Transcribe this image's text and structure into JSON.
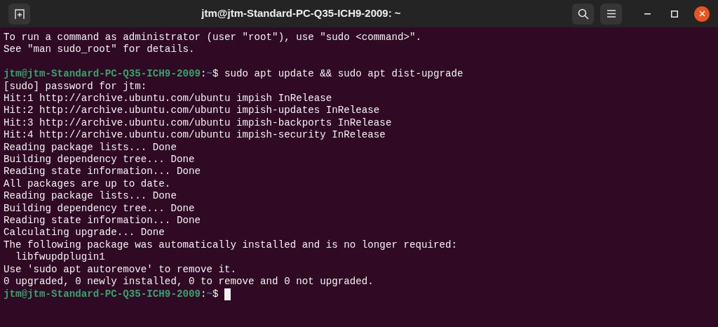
{
  "window": {
    "title": "jtm@jtm-Standard-PC-Q35-ICH9-2009: ~"
  },
  "terminal": {
    "lines": [
      {
        "kind": "output",
        "text": "To run a command as administrator (user \"root\"), use \"sudo <command>\"."
      },
      {
        "kind": "output",
        "text": "See \"man sudo_root\" for details."
      },
      {
        "kind": "blank"
      },
      {
        "kind": "prompt",
        "user_host": "jtm@jtm-Standard-PC-Q35-ICH9-2009",
        "separator": ":",
        "path": "~",
        "symbol": "$",
        "command": "sudo apt update && sudo apt dist-upgrade",
        "cursor": false
      },
      {
        "kind": "output",
        "text": "[sudo] password for jtm:"
      },
      {
        "kind": "output",
        "text": "Hit:1 http://archive.ubuntu.com/ubuntu impish InRelease"
      },
      {
        "kind": "output",
        "text": "Hit:2 http://archive.ubuntu.com/ubuntu impish-updates InRelease"
      },
      {
        "kind": "output",
        "text": "Hit:3 http://archive.ubuntu.com/ubuntu impish-backports InRelease"
      },
      {
        "kind": "output",
        "text": "Hit:4 http://archive.ubuntu.com/ubuntu impish-security InRelease"
      },
      {
        "kind": "output",
        "text": "Reading package lists... Done"
      },
      {
        "kind": "output",
        "text": "Building dependency tree... Done"
      },
      {
        "kind": "output",
        "text": "Reading state information... Done"
      },
      {
        "kind": "output",
        "text": "All packages are up to date."
      },
      {
        "kind": "output",
        "text": "Reading package lists... Done"
      },
      {
        "kind": "output",
        "text": "Building dependency tree... Done"
      },
      {
        "kind": "output",
        "text": "Reading state information... Done"
      },
      {
        "kind": "output",
        "text": "Calculating upgrade... Done"
      },
      {
        "kind": "output",
        "text": "The following package was automatically installed and is no longer required:"
      },
      {
        "kind": "output",
        "text": "  libfwupdplugin1"
      },
      {
        "kind": "output",
        "text": "Use 'sudo apt autoremove' to remove it."
      },
      {
        "kind": "output",
        "text": "0 upgraded, 0 newly installed, 0 to remove and 0 not upgraded."
      },
      {
        "kind": "prompt",
        "user_host": "jtm@jtm-Standard-PC-Q35-ICH9-2009",
        "separator": ":",
        "path": "~",
        "symbol": "$",
        "cursor": true
      }
    ]
  }
}
